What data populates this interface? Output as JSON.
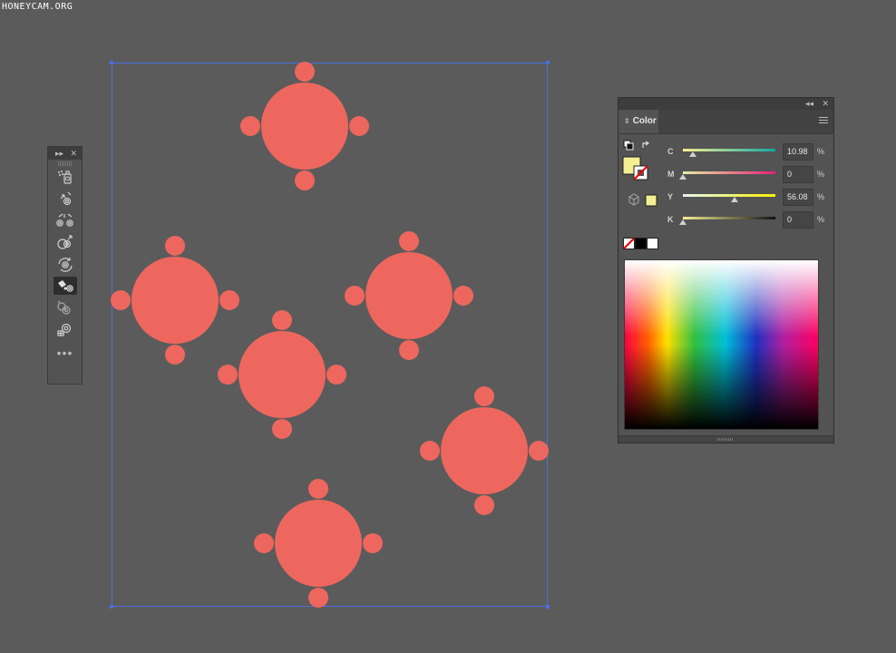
{
  "watermark": "HONEYCAM.ORG",
  "colors": {
    "shape_fill": "#ee675e",
    "selection": "#4a6fe0",
    "fill_swatch": "#f5ef94"
  },
  "tools_panel": {
    "collapse_glyph": "▸▸",
    "close_glyph": "✕",
    "more_label": "•••",
    "tools": [
      {
        "icon": "symbol-sprayer-icon"
      },
      {
        "icon": "symbol-shifter-icon"
      },
      {
        "icon": "symbol-scruncher-icon"
      },
      {
        "icon": "symbol-sizer-icon"
      },
      {
        "icon": "symbol-spinner-icon"
      },
      {
        "icon": "symbol-stainer-icon",
        "active": true
      },
      {
        "icon": "symbol-screener-icon"
      },
      {
        "icon": "symbol-styler-icon"
      }
    ]
  },
  "color_panel": {
    "collapse_glyph": "◂◂",
    "close_glyph": "✕",
    "tab_arrow": "⇕",
    "tab_label": "Color",
    "sliders": [
      {
        "label": "C",
        "value": "10.98",
        "unit": "%",
        "level": 0.1098
      },
      {
        "label": "M",
        "value": "0",
        "unit": "%",
        "level": 0
      },
      {
        "label": "Y",
        "value": "56.08",
        "unit": "%",
        "level": 0.5608
      },
      {
        "label": "K",
        "value": "0",
        "unit": "%",
        "level": 0
      }
    ]
  }
}
